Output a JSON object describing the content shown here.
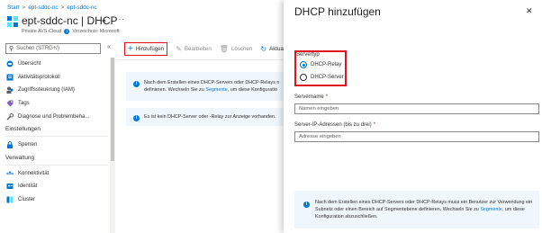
{
  "breadcrumb": {
    "start": "Start",
    "parent": "ept-sddc-nc",
    "current": "ept-sddc-nc"
  },
  "header": {
    "resource": "ept-sddc-nc",
    "separator": " | ",
    "section": "DHCP",
    "pin_glyph": "✦",
    "more_glyph": "···",
    "resource_type": "Private AVS-Cloud",
    "directory": "Verzeichnis: Microsoft"
  },
  "sidebar": {
    "search_placeholder": "Suchen (STRG+/)",
    "collapse_glyph": "«",
    "items_top": [
      {
        "label": "Übersicht",
        "icon": "overview-icon"
      },
      {
        "label": "Aktivitätsprotokoll",
        "icon": "activity-log-icon"
      },
      {
        "label": "Zugriffssteuerung (IAM)",
        "icon": "iam-icon"
      },
      {
        "label": "Tags",
        "icon": "tag-icon"
      },
      {
        "label": "Diagnose und Problembeha...",
        "icon": "diagnose-icon"
      }
    ],
    "section_settings": "Einstellungen",
    "items_settings": [
      {
        "label": "Sperren",
        "icon": "lock-icon"
      }
    ],
    "section_manage": "Verwaltung",
    "items_manage": [
      {
        "label": "Konnektivität",
        "icon": "connectivity-icon"
      },
      {
        "label": "Identität",
        "icon": "identity-icon"
      },
      {
        "label": "Cluster",
        "icon": "cluster-icon"
      }
    ]
  },
  "toolbar": {
    "add": "Hinzufügen",
    "edit": "Bearbeiten",
    "delete": "Löschen",
    "refresh": "Aktual"
  },
  "main": {
    "banner1_line1": "Nach dem Erstellen eines DHCP-Servers oder DHCP-Relays n",
    "banner1_line2_pre": "definieren. Wechseln Sie zu ",
    "banner1_link": "Segmente",
    "banner1_line2_post": ", um diese Konfiguratio",
    "banner2": "Es ist kein DHCP-Server oder -Relay zur Anzeige vorhanden."
  },
  "panel": {
    "title": "DHCP hinzufügen",
    "close_glyph": "✕",
    "servertype_label": "Servertyp",
    "radio_relay": "DHCP-Relay",
    "radio_server": "DHCP-Server",
    "servername_label": "Servername",
    "servername_placeholder": "Namen eingeben",
    "ip_label": "Server-IP-Adressen (bis zu drei)",
    "ip_placeholder": "Adresse eingeben",
    "required_mark": "*",
    "info_pre": "Nach dem Erstellen eines DHCP-Servers oder DHCP-Relays muss ein Benutzer zur Verwendung ein Subnetz oder einen Bereich auf Segmentebene definieren. Wechseln Sie zu ",
    "info_link": "Segmente",
    "info_post": ", um diese Konfiguration abzuschließen."
  },
  "colors": {
    "accent": "#0078d4",
    "highlight": "#e3111b",
    "info_bg": "#eff6fc"
  }
}
